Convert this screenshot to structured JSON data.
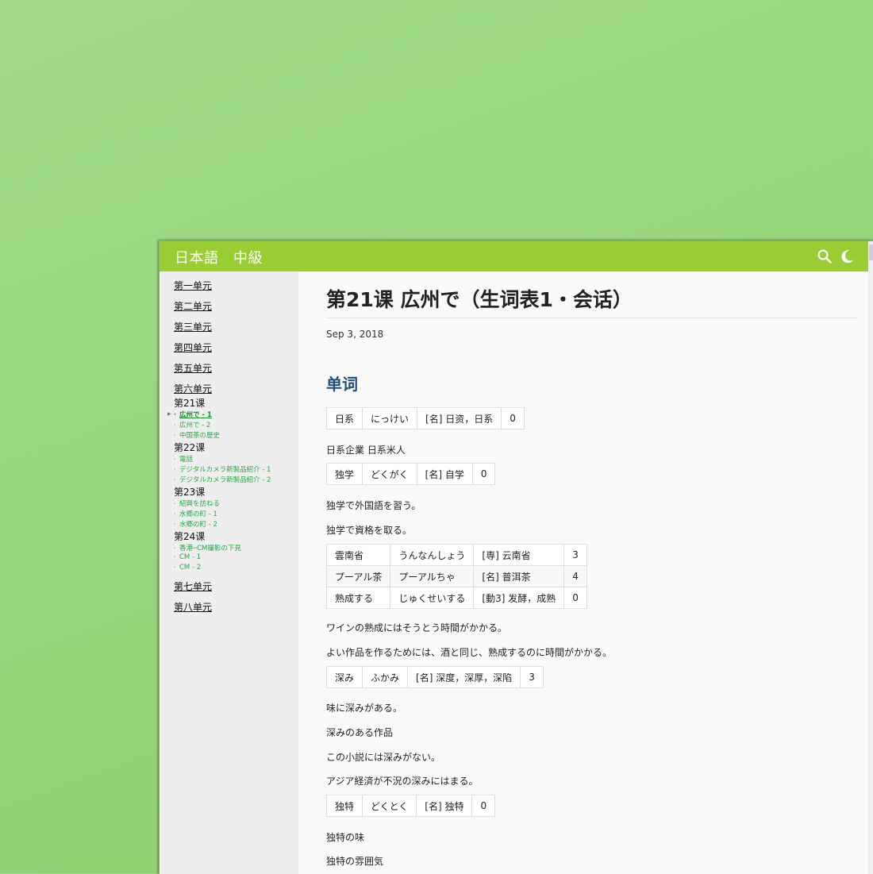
{
  "header": {
    "site_title": "日本語　中級"
  },
  "icons": {
    "search": "search-icon",
    "theme": "moon-icon"
  },
  "colors": {
    "header_bg": "#9acd32",
    "sidebar_link": "#28a745",
    "section_heading": "#1f4e79"
  },
  "sidebar": {
    "units": [
      "第一单元",
      "第二单元",
      "第三单元",
      "第四单元",
      "第五单元",
      "第六单元",
      "第七单元",
      "第八单元"
    ],
    "lessons": [
      {
        "title": "第21课",
        "items": [
          "広州で - 1",
          "広州で - 2",
          "中国茶の歴史"
        ]
      },
      {
        "title": "第22课",
        "items": [
          "電話",
          "デジタルカメラ新製品紹介 - 1",
          "デジタルカメラ新製品紹介 - 2"
        ]
      },
      {
        "title": "第23课",
        "items": [
          "紹興を訪ねる",
          "水郷の町 - 1",
          "水郷の町 - 2"
        ]
      },
      {
        "title": "第24课",
        "items": [
          "香港─CM撮影の下見",
          "CM - 1",
          "CM - 2"
        ]
      }
    ]
  },
  "article": {
    "title": "第21课 広州で（生词表1・会话）",
    "date": "Sep 3, 2018",
    "section_heading": "单词",
    "vocab_tables": [
      [
        [
          "日系",
          "にっけい",
          "[名] 日资，日系",
          "0"
        ]
      ],
      [
        [
          "独学",
          "どくがく",
          "[名] 自学",
          "0"
        ]
      ],
      [
        [
          "雲南省",
          "うんなんしょう",
          "[専] 云南省",
          "3"
        ],
        [
          "プーアル茶",
          "プーアルちゃ",
          "[名] 普洱茶",
          "4"
        ],
        [
          "熟成する",
          "じゅくせいする",
          "[動3] 发酵，成熟",
          "0"
        ]
      ],
      [
        [
          "深み",
          "ふかみ",
          "[名] 深度，深厚，深陷",
          "3"
        ]
      ],
      [
        [
          "独特",
          "どくとく",
          "[名] 独特",
          "0"
        ]
      ]
    ],
    "examples": [
      "日系企業 日系米人",
      "独学で外国語を習う。",
      "独学で資格を取る。",
      "ワインの熟成にはそうとう時間がかかる。",
      "よい作品を作るためには、酒と同じ、熟成するのに時間がかかる。",
      "味に深みがある。",
      "深みのある作品",
      "この小説には深みがない。",
      "アジア経済が不況の深みにはまる。",
      "独特の味",
      "独特の雰囲気"
    ]
  }
}
